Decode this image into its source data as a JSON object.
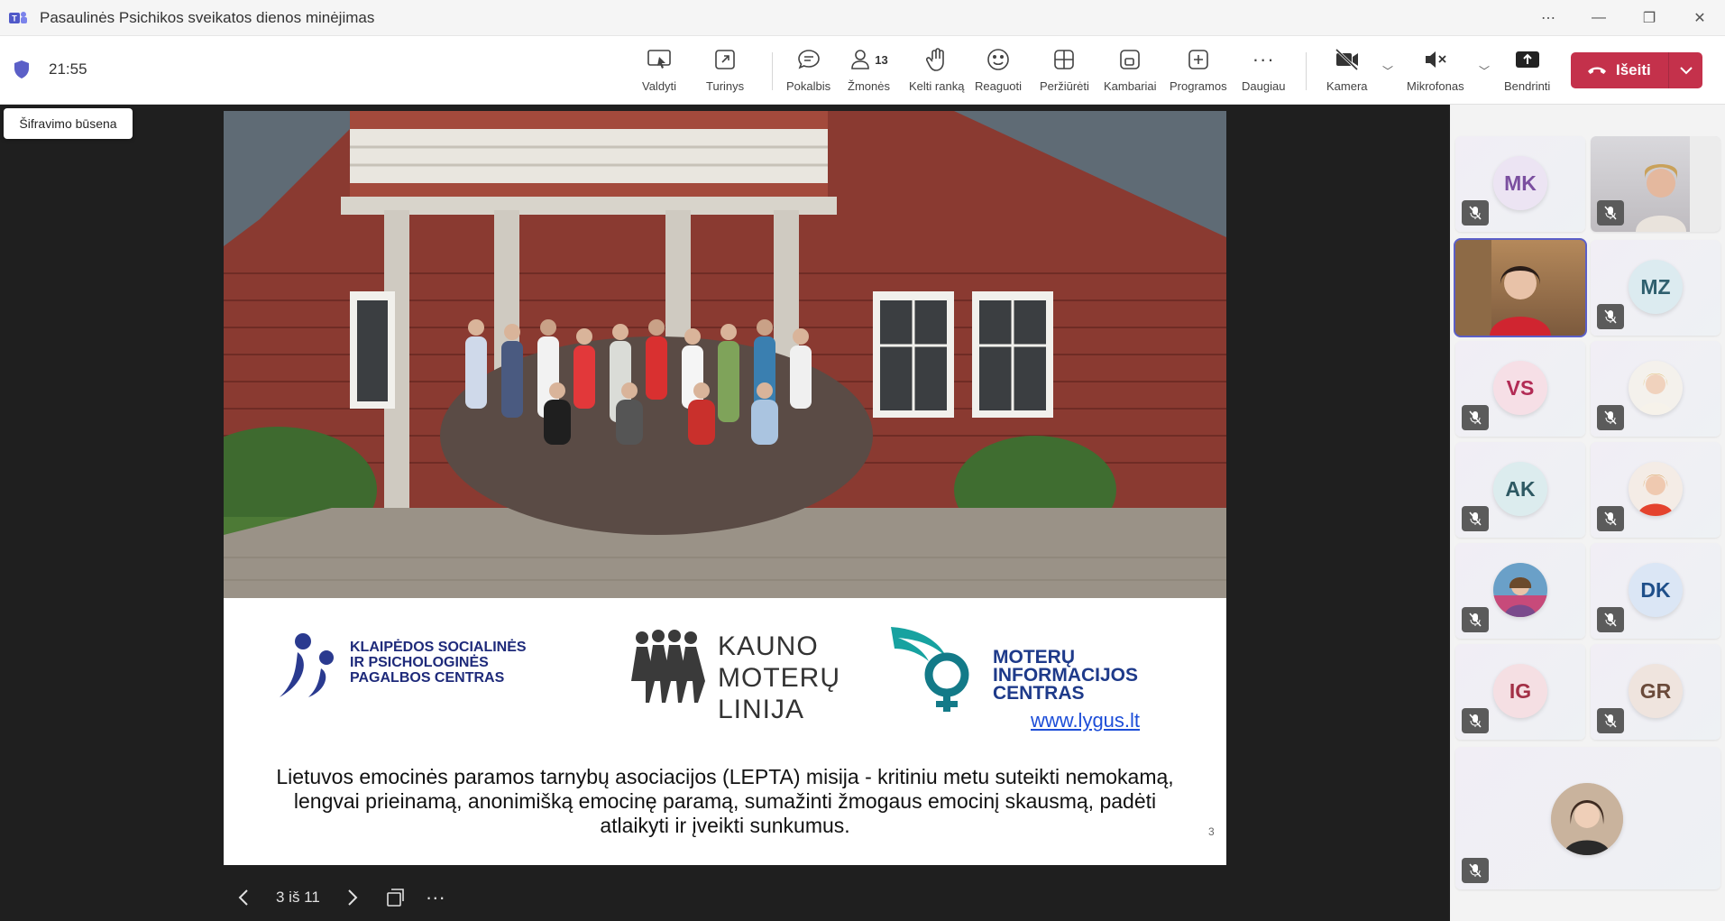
{
  "window": {
    "title": "Pasaulinės Psichikos sveikatos dienos minėjimas"
  },
  "meeting": {
    "timer": "21:55",
    "encryption_tooltip": "Šifravimo būsena"
  },
  "toolbar": {
    "control": "Valdyti",
    "content": "Turinys",
    "chat": "Pokalbis",
    "people": "Žmonės",
    "people_count": "13",
    "raise_hand": "Kelti ranką",
    "react": "Reaguoti",
    "view": "Peržiūrėti",
    "rooms": "Kambariai",
    "apps": "Programos",
    "more": "Daugiau",
    "camera": "Kamera",
    "microphone": "Mikrofonas",
    "share": "Bendrinti",
    "leave": "Išeiti"
  },
  "slide": {
    "logo1_line1": "KLAIPĖDOS SOCIALINĖS",
    "logo1_line2": "IR PSICHOLOGINĖS",
    "logo1_line3": "PAGALBOS CENTRAS",
    "logo2_line1": "KAUNO",
    "logo2_line2": "MOTERŲ",
    "logo2_line3": "LINIJA",
    "logo3_line1": "MOTERŲ",
    "logo3_line2": "INFORMACIJOS",
    "logo3_line3": "CENTRAS",
    "logo3_url": "www.lygus.lt",
    "mission_line1": "Lietuvos emocinės paramos tarnybų asociacijos (LEPTA) misija - kritiniu metu suteikti nemokamą,",
    "mission_line2": "lengvai prieinamą, anonimišką emocinę paramą, sumažinti žmogaus emocinį skausmą, padėti",
    "mission_line3": "atlaikyti ir įveikti sunkumus.",
    "page_number": "3"
  },
  "pager": {
    "position": "3 iš 11"
  },
  "participants": [
    {
      "initials": "MK",
      "color": "#7b4fa0",
      "bg": "#ece4f3",
      "video": false
    },
    {
      "initials": "",
      "video": true
    },
    {
      "initials": "",
      "video": true,
      "active": true
    },
    {
      "initials": "MZ",
      "color": "#2f5f6e",
      "bg": "#dcebf0",
      "video": false
    },
    {
      "initials": "VS",
      "color": "#b22b55",
      "bg": "#f6dfe6",
      "video": false
    },
    {
      "initials": "",
      "video": false,
      "photo": true
    },
    {
      "initials": "AK",
      "color": "#2e5963",
      "bg": "#dcecee",
      "video": false
    },
    {
      "initials": "",
      "video": false,
      "photo": true
    },
    {
      "initials": "",
      "video": false,
      "photo": true
    },
    {
      "initials": "DK",
      "color": "#1f4f8a",
      "bg": "#dbe6f5",
      "video": false
    },
    {
      "initials": "IG",
      "color": "#a33046",
      "bg": "#f5dfe3",
      "video": false
    },
    {
      "initials": "GR",
      "color": "#6a4a3a",
      "bg": "#efe4de",
      "video": false
    },
    {
      "initials": "",
      "video": false,
      "photo": true
    }
  ]
}
